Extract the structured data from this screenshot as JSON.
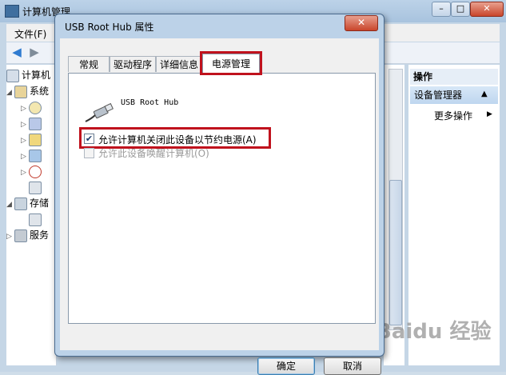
{
  "main_window": {
    "title": "计算机管理",
    "menu": {
      "file": "文件(F)"
    },
    "controls": {
      "minimize": "–",
      "maximize": "□",
      "close": "✕"
    }
  },
  "tree": [
    {
      "label": "计算机",
      "expander": ""
    },
    {
      "label": "系统",
      "expander": "◢"
    },
    {
      "label": "",
      "expander": "▷"
    },
    {
      "label": "",
      "expander": "▷"
    },
    {
      "label": "",
      "expander": "▷"
    },
    {
      "label": "",
      "expander": "▷"
    },
    {
      "label": "",
      "expander": "▷"
    },
    {
      "label": "",
      "expander": ""
    },
    {
      "label": "存储",
      "expander": "◢"
    },
    {
      "label": "",
      "expander": ""
    },
    {
      "label": "服务",
      "expander": "▷"
    }
  ],
  "actions": {
    "header": "操作",
    "device_manager": "设备管理器",
    "device_manager_arrow": "▲",
    "more_actions": "更多操作",
    "more_actions_arrow": "▶"
  },
  "watermark": "Baidu 经验",
  "dialog": {
    "title": "USB Root Hub 属性",
    "close": "✕",
    "tabs": {
      "general": "常规",
      "driver": "驱动程序",
      "details": "详细信息",
      "power": "电源管理"
    },
    "device_name": "USB Root Hub",
    "allow_off_label": "允许计算机关闭此设备以节约电源(A)",
    "allow_off_checked": true,
    "allow_off_mark": "✔",
    "allow_wake_label": "允许此设备唤醒计算机(O)",
    "allow_wake_checked": false,
    "ok_label": "确定",
    "cancel_label": "取消"
  },
  "colors": {
    "highlight_red": "#c0121d",
    "titlebar": "#bcd2e8",
    "selected_action": "#bed6ef"
  }
}
